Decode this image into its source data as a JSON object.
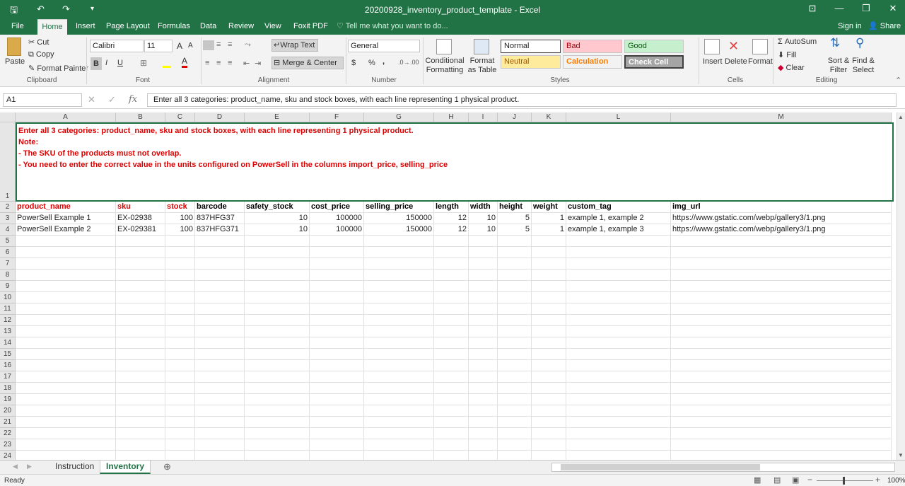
{
  "window": {
    "title": "20200928_inventory_product_template - Excel"
  },
  "quick_access": {
    "save": "🖫",
    "undo": "↶",
    "redo": "↷",
    "customize": "▾"
  },
  "window_controls": {
    "ribbon_display": "⊡",
    "minimize": "—",
    "restore": "❐",
    "close": "✕"
  },
  "ribbon_tabs": [
    "File",
    "Home",
    "Insert",
    "Page Layout",
    "Formulas",
    "Data",
    "Review",
    "View",
    "Foxit PDF"
  ],
  "active_tab": "Home",
  "tell_me": "Tell me what you want to do...",
  "account": {
    "signin": "Sign in",
    "share": "Share"
  },
  "clipboard": {
    "paste": "Paste",
    "cut": "Cut",
    "copy": "Copy",
    "format_painter": "Format Painter",
    "label": "Clipboard"
  },
  "font": {
    "name": "Calibri",
    "size": "11",
    "bold": "B",
    "italic": "I",
    "underline": "U",
    "grow": "A",
    "shrink": "A",
    "label": "Font"
  },
  "alignment": {
    "wrap_text": "Wrap Text",
    "merge_center": "Merge & Center",
    "label": "Alignment"
  },
  "number": {
    "format": "General",
    "currency": "$",
    "percent": "%",
    "comma": ",",
    "label": "Number"
  },
  "styles": {
    "conditional_formatting": "Conditional Formatting",
    "format_as_table": "Format as Table",
    "normal": "Normal",
    "bad": "Bad",
    "good": "Good",
    "neutral": "Neutral",
    "calculation": "Calculation",
    "check_cell": "Check Cell",
    "label": "Styles"
  },
  "cells_group": {
    "insert": "Insert",
    "delete": "Delete",
    "format": "Format",
    "label": "Cells"
  },
  "editing": {
    "autosum": "AutoSum",
    "fill": "Fill",
    "clear": "Clear",
    "sort_filter": "Sort & Filter",
    "find_select": "Find & Select",
    "label": "Editing"
  },
  "formula_bar": {
    "name_box": "A1",
    "cancel": "✕",
    "enter": "✓",
    "fx": "fx",
    "content": "Enter all 3 categories: product_name, sku and stock boxes, with each line representing 1 physical product."
  },
  "columns": [
    "A",
    "B",
    "C",
    "D",
    "E",
    "F",
    "G",
    "H",
    "I",
    "J",
    "K",
    "L",
    "M"
  ],
  "row_numbers": [
    "1",
    "2",
    "3",
    "4",
    "5",
    "6",
    "7",
    "8",
    "9",
    "10",
    "11",
    "12",
    "13",
    "14",
    "15",
    "16",
    "17",
    "18",
    "19",
    "20",
    "21",
    "22",
    "23",
    "24"
  ],
  "note": {
    "line1": "Enter all 3 categories: product_name, sku and stock boxes, with each line representing 1 physical product.",
    "line2": "Note:",
    "line3": "- The SKU of the products must not overlap.",
    "line4": "- You need to enter the correct value in the units configured on PowerSell in the columns import_price, selling_price"
  },
  "headers": [
    "product_name",
    "sku",
    "stock",
    "barcode",
    "safety_stock",
    "cost_price",
    "selling_price",
    "length",
    "width",
    "height",
    "weight",
    "custom_tag",
    "img_url"
  ],
  "rows": [
    [
      "PowerSell Example 1",
      "EX-02938",
      "100",
      "837HFG37",
      "10",
      "100000",
      "150000",
      "12",
      "10",
      "5",
      "1",
      "example 1, example 2",
      "https://www.gstatic.com/webp/gallery3/1.png"
    ],
    [
      "PowerSell Example 2",
      "EX-029381",
      "100",
      "837HFG371",
      "10",
      "100000",
      "150000",
      "12",
      "10",
      "5",
      "1",
      "example 1, example 3",
      "https://www.gstatic.com/webp/gallery3/1.png"
    ]
  ],
  "sheets": [
    "Instruction",
    "Inventory"
  ],
  "active_sheet": "Inventory",
  "status": {
    "ready": "Ready",
    "zoom": "100%"
  },
  "colors": {
    "excel_green": "#217346",
    "required_red": "#e00000"
  }
}
